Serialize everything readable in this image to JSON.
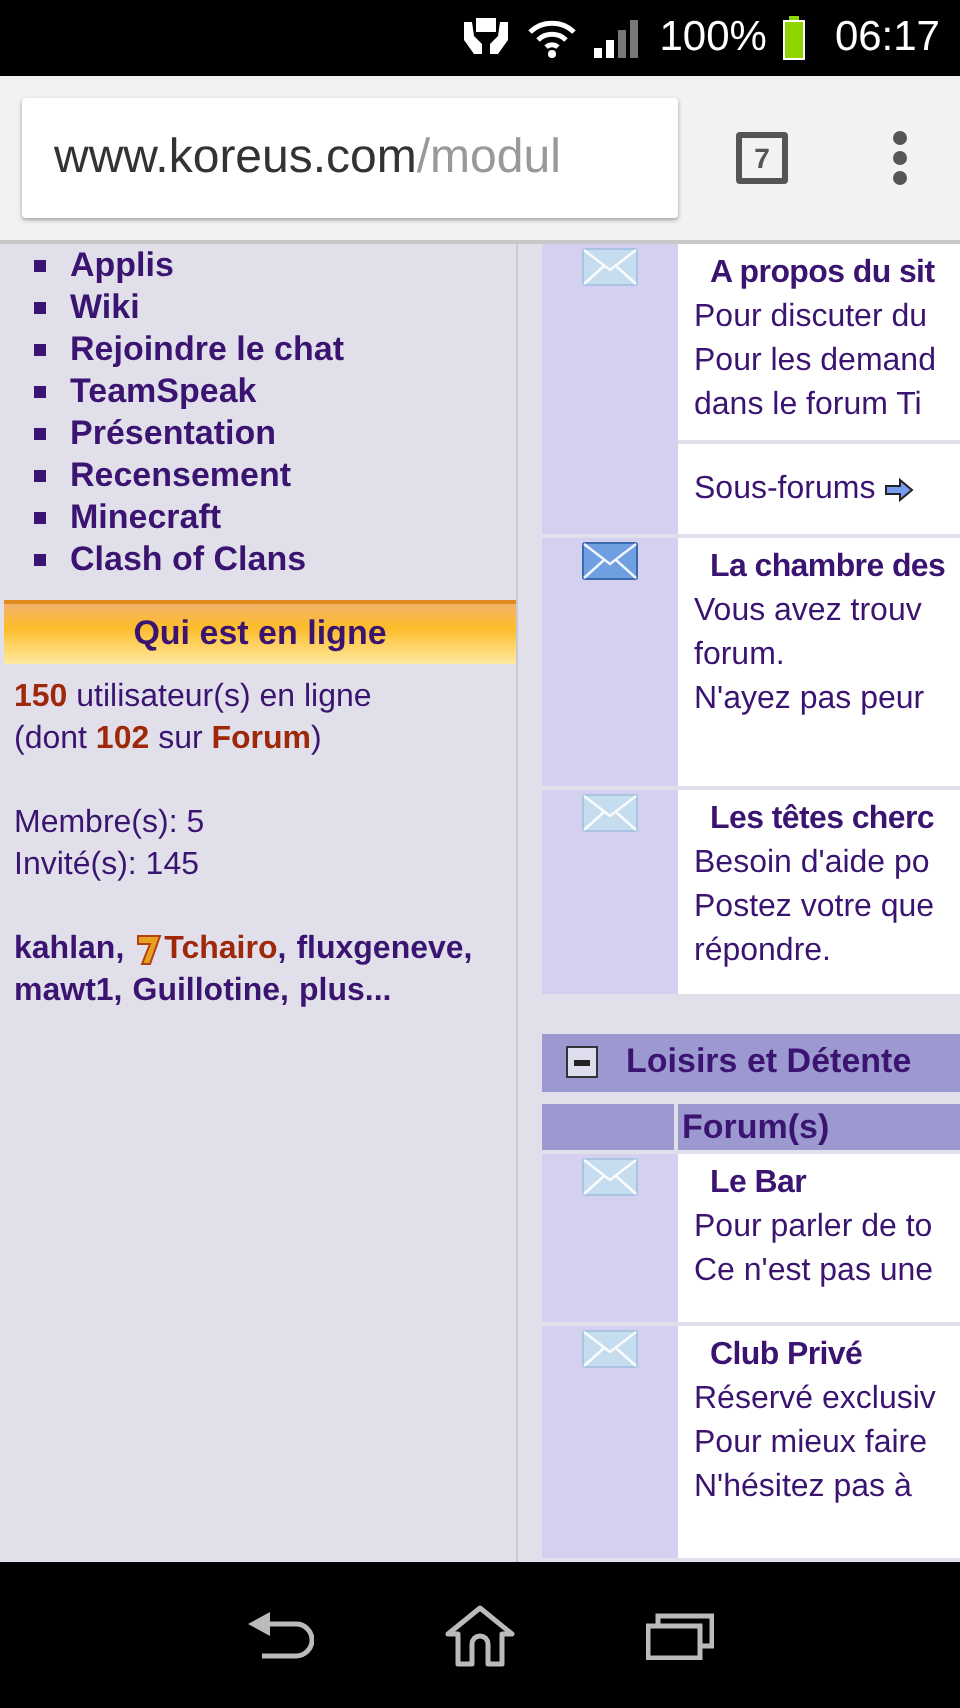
{
  "status_bar": {
    "battery": "100%",
    "time": "06:17"
  },
  "browser": {
    "url_domain": "www.koreus.com",
    "url_path": "/modul",
    "tab_count": "7"
  },
  "sidebar": {
    "menu": [
      "Applis",
      "Wiki",
      "Rejoindre le chat",
      "TeamSpeak",
      "Présentation",
      "Recensement",
      "Minecraft",
      "Clash of Clans"
    ],
    "online_block": {
      "title": "Qui est en ligne",
      "summary": [
        "**150** utilisateur(s) en ligne",
        "(dont **102** sur **Forum**)"
      ],
      "counts": [
        "Membre(s): 5",
        "Invité(s): 145"
      ],
      "users": [
        {
          "name": "kahlan",
          "separator": ",",
          "color": "#3a1470",
          "badge": false
        },
        {
          "name": "Tchairo",
          "separator": ",",
          "color": "#a0280a",
          "badge": true
        },
        {
          "name": "fluxgeneve",
          "separator": ",",
          "color": "#3a1470",
          "badge": false
        },
        {
          "name": "mawt1",
          "separator": ",",
          "color": "#3a1470",
          "badge": false
        },
        {
          "name": "Guillotine",
          "separator": ",",
          "color": "#3a1470",
          "badge": false
        }
      ],
      "more": "plus..."
    }
  },
  "forums_top": [
    {
      "title": "A propos du sit",
      "unread": false,
      "lines": [
        "Pour discuter du",
        "Pour les demand",
        "dans le forum Ti"
      ],
      "subforums": "Sous-forums"
    },
    {
      "title": "La chambre des",
      "unread": true,
      "lines": [
        "Vous avez trouv",
        "forum.",
        "N'ayez pas peur"
      ]
    },
    {
      "title": "Les têtes cherc",
      "unread": false,
      "lines": [
        "Besoin d'aide po",
        "Postez votre que",
        "répondre."
      ]
    }
  ],
  "category": {
    "title": "Loisirs et Détente",
    "expanded": true,
    "column_header": "Forum(s)",
    "forums": [
      {
        "title": "Le Bar",
        "unread": false,
        "lines": [
          "Pour parler de to",
          "Ce n'est pas une"
        ]
      },
      {
        "title": "Club Privé",
        "unread": false,
        "lines": [
          "Réservé exclusiv",
          "Pour mieux faire",
          "N'hésitez pas à"
        ]
      }
    ]
  }
}
